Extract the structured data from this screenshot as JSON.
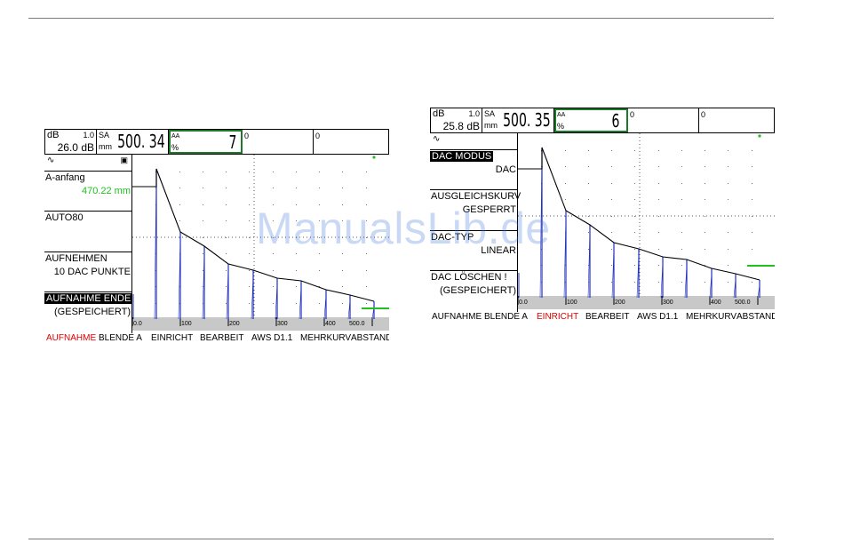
{
  "screens": [
    {
      "db_label": "dB",
      "db_step": "1.0",
      "db_value": "26.0 dB",
      "sa_label": "SA",
      "sa_unit": "mm",
      "sa_value": "500. 34",
      "a_label": "AA",
      "a_sub": "%",
      "a_value": "7",
      "field3": "0",
      "field4": "0",
      "menu": [
        {
          "label": "A-anfang",
          "value": "470.22 mm",
          "highlight": false
        },
        {
          "label": "AUTO80",
          "value": "",
          "highlight": false
        },
        {
          "label": "AUFNEHMEN",
          "value": "10 DAC PUNKTE",
          "highlight": false
        },
        {
          "label": "AUFNAHME ENDE",
          "value": "(GESPEICHERT)",
          "highlight": true
        }
      ],
      "bottom": [
        "AUFNAHME",
        "BLENDE A",
        "EINRICHT",
        "BEARBEIT",
        "AWS D1.1",
        "MEHRKURV",
        "ABSTAND"
      ],
      "active_tab": 0,
      "axis_ticks": [
        "0.0",
        "100",
        "200",
        "300",
        "400",
        "500.0"
      ]
    },
    {
      "db_label": "dB",
      "db_step": "1.0",
      "db_value": "25.8 dB",
      "sa_label": "SA",
      "sa_unit": "mm",
      "sa_value": "500. 35",
      "a_label": "AA",
      "a_sub": "%",
      "a_value": "6",
      "field3": "0",
      "field4": "0",
      "menu": [
        {
          "label": "DAC MODUS",
          "value": "DAC",
          "highlight": true
        },
        {
          "label": "AUSGLEICHSKURV",
          "value": "GESPERRT",
          "highlight": false
        },
        {
          "label": "DAC-TYP",
          "value": "LINEAR",
          "highlight": false
        },
        {
          "label": "DAC LÖSCHEN !",
          "value": "(GESPEICHERT)",
          "highlight": false
        }
      ],
      "bottom": [
        "AUFNAHME",
        "BLENDE A",
        "EINRICHT",
        "BEARBEIT",
        "AWS D1.1",
        "MEHRKURV",
        "ABSTAND"
      ],
      "active_tab": 2,
      "axis_ticks": [
        "0.0",
        "100",
        "200",
        "300",
        "400",
        "500.0"
      ]
    }
  ],
  "watermark": "ManualsLib.de",
  "colors": {
    "accent_green": "#20c020",
    "active_tab_red": "#e00000",
    "trace_blue": "#2030c0"
  }
}
